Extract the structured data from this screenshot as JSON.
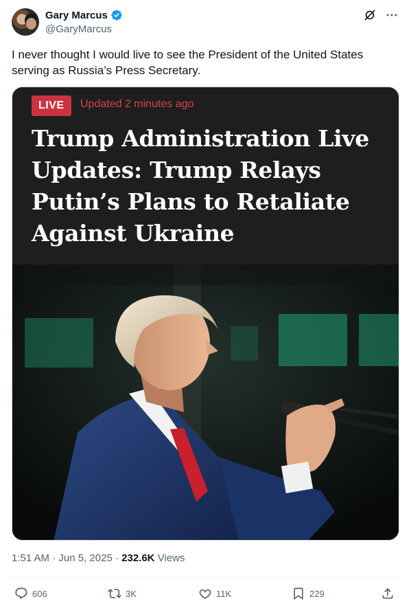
{
  "author": {
    "display_name": "Gary Marcus",
    "handle": "@GaryMarcus",
    "verified": true
  },
  "tweet": {
    "text": "I never thought I would live to see the President of the United States serving as Russia’s Press Secretary."
  },
  "media": {
    "live_label": "LIVE",
    "updated_text": "Updated 2 minutes ago",
    "headline": "Trump Administration Live Updates: Trump Relays Putin’s Plans to Retaliate Against Ukraine"
  },
  "meta": {
    "time": "1:51 AM",
    "separator": "·",
    "date": "Jun 5, 2025",
    "views_count": "232.6K",
    "views_label": "Views"
  },
  "actions": {
    "replies": "606",
    "reposts": "3K",
    "likes": "11K",
    "bookmarks": "229"
  },
  "colors": {
    "verified": "#1d9bf0",
    "live_badge": "#cc3340",
    "secondary_text": "#536471",
    "primary_text": "#0f1419"
  },
  "icons": {
    "verified": "verified-badge-icon",
    "grok": "grok-icon",
    "more": "more-icon",
    "reply": "reply-icon",
    "repost": "repost-icon",
    "like": "heart-icon",
    "bookmark": "bookmark-icon",
    "share": "share-icon"
  }
}
